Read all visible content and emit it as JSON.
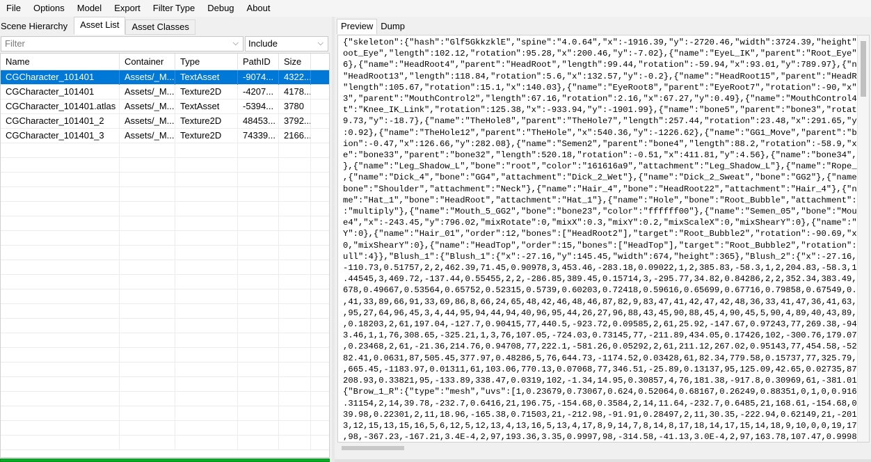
{
  "menu": [
    "File",
    "Options",
    "Model",
    "Export",
    "Filter Type",
    "Debug",
    "About"
  ],
  "left_tabs": [
    "Scene Hierarchy",
    "Asset List",
    "Asset Classes"
  ],
  "filter": {
    "placeholder": "Filter",
    "include_value": "Include"
  },
  "columns": [
    "Name",
    "Container",
    "Type",
    "PathID",
    "Size"
  ],
  "rows": [
    {
      "name": "CGCharacter_101401",
      "container": "Assets/_M...",
      "type": "TextAsset",
      "pathid": "-9074...",
      "size": "4322..."
    },
    {
      "name": "CGCharacter_101401",
      "container": "Assets/_M...",
      "type": "Texture2D",
      "pathid": "-4207...",
      "size": "4178..."
    },
    {
      "name": "CGCharacter_101401.atlas",
      "container": "Assets/_M...",
      "type": "TextAsset",
      "pathid": "-5394...",
      "size": "3780"
    },
    {
      "name": "CGCharacter_101401_2",
      "container": "Assets/_M...",
      "type": "Texture2D",
      "pathid": "48453...",
      "size": "3792..."
    },
    {
      "name": "CGCharacter_101401_3",
      "container": "Assets/_M...",
      "type": "Texture2D",
      "pathid": "74339...",
      "size": "2166..."
    }
  ],
  "right_tabs": [
    "Preview",
    "Dump"
  ],
  "preview_lines": [
    "{\"skeleton\":{\"hash\":\"Glf5GkkzklE\",\"spine\":\"4.0.64\",\"x\":-1916.39,\"y\":-2720.46,\"width\":3724.39,\"height\":5640",
    "oot_Eye\",\"length\":102.12,\"rotation\":95.28,\"x\":200.46,\"y\":-7.02},{\"name\":\"EyeL_IK\",\"parent\":\"Root_Eye\",\"x\":",
    "6},{\"name\":\"HeadRoot4\",\"parent\":\"HeadRoot\",\"length\":99.44,\"rotation\":-59.94,\"x\":93.01,\"y\":789.97},{\"name\":",
    "\"HeadRoot13\",\"length\":118.84,\"rotation\":5.6,\"x\":132.57,\"y\":-0.2},{\"name\":\"HeadRoot15\",\"parent\":\"HeadRoot14",
    "\"length\":105.67,\"rotation\":15.1,\"x\":140.03},{\"name\":\"EyeRoot8\",\"parent\":\"EyeRoot7\",\"rotation\":-90,\"x\":3.47",
    "3\",\"parent\":\"MouthControl2\",\"length\":67.16,\"rotation\":2.16,\"x\":67.27,\"y\":0.49},{\"name\":\"MouthControl4\",\"pa",
    "t\":\"Knee_IK_Link\",\"rotation\":125.38,\"x\":-933.94,\"y\":-1901.99},{\"name\":\"bone5\",\"parent\":\"bone3\",\"rotation\":",
    "9.73,\"y\":-18.7},{\"name\":\"TheHole8\",\"parent\":\"TheHole7\",\"length\":257.44,\"rotation\":23.48,\"x\":291.65,\"y\":-6.",
    ":0.92},{\"name\":\"TheHole12\",\"parent\":\"TheHole\",\"x\":540.36,\"y\":-1226.62},{\"name\":\"GG1_Move\",\"parent\":\"bone4\"",
    "ion\":-0.47,\"x\":126.66,\"y\":282.08},{\"name\":\"Semen2\",\"parent\":\"bone4\",\"length\":88.2,\"rotation\":-58.9,\"x\"",
    "e\":\"bone33\",\"parent\":\"bone32\",\"length\":520.18,\"rotation\":-0.51,\"x\":411.81,\"y\":4.56},{\"name\":\"bone34\",\"pare",
    "},{\"name\":\"Leg_Shadow_L\",\"bone\":\"root\",\"color\":\"161616a9\",\"attachment\":\"Leg_Shadow_L\"},{\"name\":\"Rope_L\",\"b",
    ",{\"name\":\"Dick_4\",\"bone\":\"GG4\",\"attachment\":\"Dick_2_Wet\"},{\"name\":\"Dick_2_Sweat\",\"bone\":\"GG2\"},{\"name\":\"Se",
    "bone\":\"Shoulder\",\"attachment\":\"Neck\"},{\"name\":\"Hair_4\",\"bone\":\"HeadRoot22\",\"attachment\":\"Hair_4\"},{\"name\":",
    "me\":\"Hat_1\",\"bone\":\"HeadRoot\",\"attachment\":\"Hat_1\"},{\"name\":\"Hole\",\"bone\":\"Root_Bubble\",\"attachment\":\"Hole",
    ":\"multiply\"},{\"name\":\"Mouth_5_GG2\",\"bone\":\"bone23\",\"color\":\"ffffff00\"},{\"name\":\"Semen_05\",\"bone\":\"Mouth_S",
    "e4\",\"x\":-243.45,\"y\":796.02,\"mixRotate\":0,\"mixX\":0.3,\"mixY\":0.2,\"mixScaleX\":0,\"mixShearY\":0},{\"name\":\"bone4",
    "Y\":0},{\"name\":\"Hair_01\",\"order\":12,\"bones\":[\"HeadRoot2\"],\"target\":\"Root_Bubble2\",\"rotation\":-90.69,\"x\":-22",
    "0,\"mixShearY\":0},{\"name\":\"HeadTop\",\"order\":15,\"bones\":[\"HeadTop\"],\"target\":\"Root_Bubble2\",\"rotation\":0.49,",
    "ull\":4}},\"Blush_1\":{\"Blush_1\":{\"x\":-27.16,\"y\":145.45,\"width\":674,\"height\":365},\"Blush_2\":{\"x\":-27.16,\"y\":1",
    "-110.73,0.51757,2,2,462.39,71.45,0.90978,3,453.46,-283.18,0.09022,1,2,385.83,-58.3,1,2,204.83,-58.3,1,1,",
    ".44545,3,469.72,-137.44,0.55455,2,2,-286.85,389.45,0.15714,3,-295.77,34.82,0.84286,2,2,352.34,383.49,0.154",
    "678,0.49667,0.53564,0.65752,0.52315,0.5739,0.60203,0.72418,0.59616,0.65699,0.67716,0.79858,0.67549,0.69386",
    ",41,33,89,66,91,33,69,86,8,66,24,65,48,42,46,48,46,87,82,9,83,47,41,42,47,42,48,36,33,41,47,36,41,63,66,33",
    ",95,27,64,96,45,3,4,44,95,94,44,94,40,96,95,44,26,27,96,88,43,45,90,88,45,4,90,45,5,90,4,89,40,43,89,43,88",
    ",0.18203,2,61,197.04,-127.7,0.90415,77,440.5,-923.72,0.09585,2,61,25.92,-147.67,0.97243,77,269.38,-943.69,",
    "3.46,1,1,76,308.65,-325.21,1,3,76,107.05,-724.03,0.73145,77,-211.89,434.05,0.17426,102,-300.76,179.07,0.09",
    ",0.23468,2,61,-21.36,214.76,0.94708,77,222.1,-581.26,0.05292,2,61,211.12,267.02,0.95143,77,454.58,-529,0.0",
    "82.41,0.0631,87,505.45,377.97,0.48286,5,76,644.73,-1174.52,0.03428,61,82.34,779.58,0.15737,77,325.79,-16.4",
    ",665.45,-1183.97,0.01311,61,103.06,770.13,0.07068,77,346.51,-25.89,0.13137,95,125.09,42.65,0.02735,87,473.",
    "208.93,0.33821,95,-133.89,338.47,0.0319,102,-1.34,14.95,0.30857,4,76,181.38,-917.8,0.30969,61,-381.01,1036",
    "{\"Brow_1_R\":{\"type\":\"mesh\",\"uvs\":[1,0.23679,0.73067,0.624,0.52064,0.68167,0.26249,0.88351,0,1,0,0.91647,0.",
    ".31154,2,14,39.78,-232.7,0.6416,21,196.75,-154.68,0.3584,2,14,11.64,-232.7,0.6485,21,168.61,-154.68,0.3515",
    "39.98,0.22301,2,11,18.96,-165.38,0.71503,21,-212.98,-91.91,0.28497,2,11,30.35,-222.94,0.62149,21,-201.59,-",
    "3,12,15,13,15,16,5,6,12,5,12,13,4,13,16,5,13,4,17,8,9,14,7,8,14,8,17,18,14,17,15,14,18,9,10,0,0,19,17,18,1",
    ",98,-367.23,-167.21,3.4E-4,2,97,193.36,3.35,0.9997,98,-314.58,-41.13,3.0E-4,2,97,163.78,107.47,0.99981,98,",
    "2,126,-264.95,-104.58,0.64857,4,97,497.12,-7.89,0.05208,98,-12.24,-9.7,0.05397,105,-17.85,14.85,0.05394,12",
    ",0.42093,0.78919,0.51052,0.71389,0.91225,0.63,1,0.51834,1,0.39132,1,0.24937,1,0.16313,1,0.07964,1,0.08176,",
    "21,14,104.94,19.77,0.51207,50,19.24,-124.93,0.36571,3,13,77.89,-110.68,0.16574,14,77.68,6.96,0.69426,50,6"
  ]
}
